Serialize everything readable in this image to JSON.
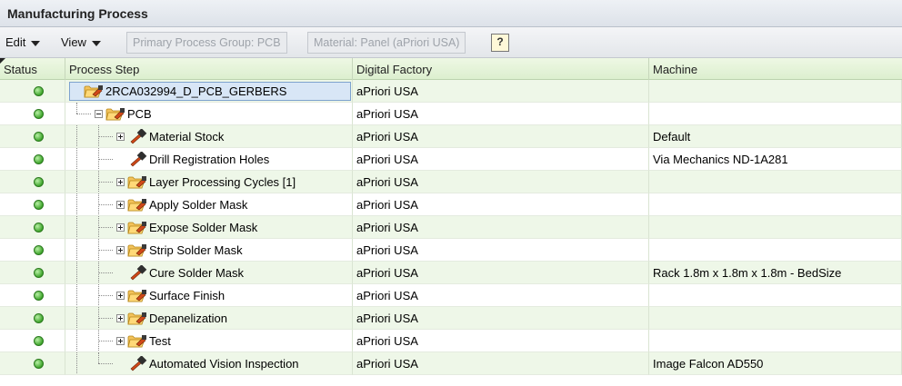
{
  "panel": {
    "title": "Manufacturing Process"
  },
  "toolbar": {
    "edit_label": "Edit",
    "view_label": "View",
    "process_group": "Primary Process Group: PCB",
    "material": "Material: Panel (aPriori USA)",
    "help_glyph": "?"
  },
  "columns": {
    "status": "Status",
    "step": "Process Step",
    "factory": "Digital Factory",
    "machine": "Machine"
  },
  "status_color": "#3fa52c",
  "rows": [
    {
      "name": "2RCA032994_D_PCB_GERBERS",
      "depth": 0,
      "kind": "folder",
      "expander": "minus",
      "factory": "aPriori USA",
      "machine": "",
      "selected": true
    },
    {
      "name": "PCB",
      "depth": 1,
      "kind": "folder",
      "expander": "minus",
      "factory": "aPriori USA",
      "machine": ""
    },
    {
      "name": "Material Stock",
      "depth": 2,
      "kind": "tool",
      "expander": "plus",
      "factory": "aPriori USA",
      "machine": "Default"
    },
    {
      "name": "Drill Registration Holes",
      "depth": 2,
      "kind": "tool",
      "expander": "none",
      "factory": "aPriori USA",
      "machine": "Via Mechanics ND-1A281"
    },
    {
      "name": "Layer Processing Cycles [1]",
      "depth": 2,
      "kind": "folder",
      "expander": "plus",
      "factory": "aPriori USA",
      "machine": ""
    },
    {
      "name": "Apply Solder Mask",
      "depth": 2,
      "kind": "folder",
      "expander": "plus",
      "factory": "aPriori USA",
      "machine": ""
    },
    {
      "name": "Expose Solder Mask",
      "depth": 2,
      "kind": "folder",
      "expander": "plus",
      "factory": "aPriori USA",
      "machine": ""
    },
    {
      "name": "Strip Solder Mask",
      "depth": 2,
      "kind": "folder",
      "expander": "plus",
      "factory": "aPriori USA",
      "machine": ""
    },
    {
      "name": "Cure Solder Mask",
      "depth": 2,
      "kind": "tool",
      "expander": "none",
      "factory": "aPriori USA",
      "machine": "Rack 1.8m x 1.8m x 1.8m - BedSize"
    },
    {
      "name": "Surface Finish",
      "depth": 2,
      "kind": "folder",
      "expander": "plus",
      "factory": "aPriori USA",
      "machine": ""
    },
    {
      "name": "Depanelization",
      "depth": 2,
      "kind": "folder",
      "expander": "plus",
      "factory": "aPriori USA",
      "machine": ""
    },
    {
      "name": "Test",
      "depth": 2,
      "kind": "folder",
      "expander": "plus",
      "factory": "aPriori USA",
      "machine": ""
    },
    {
      "name": "Automated Vision Inspection",
      "depth": 2,
      "kind": "tool",
      "expander": "none",
      "factory": "aPriori USA",
      "machine": "Image Falcon AD550"
    }
  ]
}
